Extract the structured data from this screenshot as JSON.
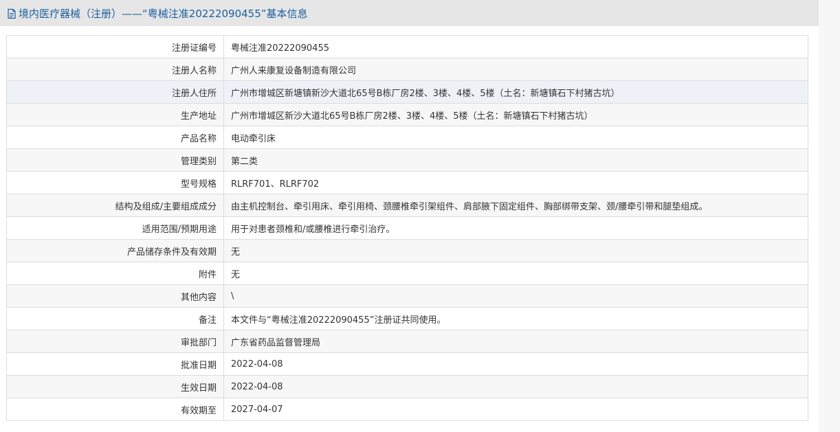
{
  "title": "境内医疗器械（注册）——“粤械注准20222090455”基本信息",
  "icons": {
    "title": "document-icon"
  },
  "colors": {
    "title": "#1a5f9e",
    "header_bg": "#e6e6e6",
    "border": "#dcdcdc"
  },
  "rows": [
    {
      "label": "注册证编号",
      "value": "粤械注准20222090455"
    },
    {
      "label": "注册人名称",
      "value": "广州人来康复设备制造有限公司"
    },
    {
      "label": "注册人住所",
      "value": "广州市增城区新塘镇新沙大道北65号B栋厂房2楼、3楼、4楼、5楼（土名：新塘镇石下村猪古坑）"
    },
    {
      "label": "生产地址",
      "value": "广州市增城区新沙大道北65号B栋厂房2楼、3楼、4楼、5楼（土名：新塘镇石下村猪古坑）"
    },
    {
      "label": "产品名称",
      "value": "电动牵引床"
    },
    {
      "label": "管理类别",
      "value": "第二类"
    },
    {
      "label": "型号规格",
      "value": "RLRF701、RLRF702"
    },
    {
      "label": "结构及组成/主要组成成分",
      "value": "由主机控制台、牵引用床、牵引用椅、颈腰椎牵引架组件、肩部腋下固定组件、胸部绑带支架、颈/腰牵引带和腿垫组成。"
    },
    {
      "label": "适用范围/预期用途",
      "value": "用于对患者颈椎和/或腰椎进行牵引治疗。"
    },
    {
      "label": "产品储存条件及有效期",
      "value": "无"
    },
    {
      "label": "附件",
      "value": "无"
    },
    {
      "label": "其他内容",
      "value": "\\"
    },
    {
      "label": "备注",
      "value": "本文件与“粤械注准20222090455”注册证共同使用。"
    },
    {
      "label": "审批部门",
      "value": "广东省药品监督管理局"
    },
    {
      "label": "批准日期",
      "value": "2022-04-08"
    },
    {
      "label": "生效日期",
      "value": "2022-04-08"
    },
    {
      "label": "有效期至",
      "value": "2027-04-07"
    }
  ]
}
